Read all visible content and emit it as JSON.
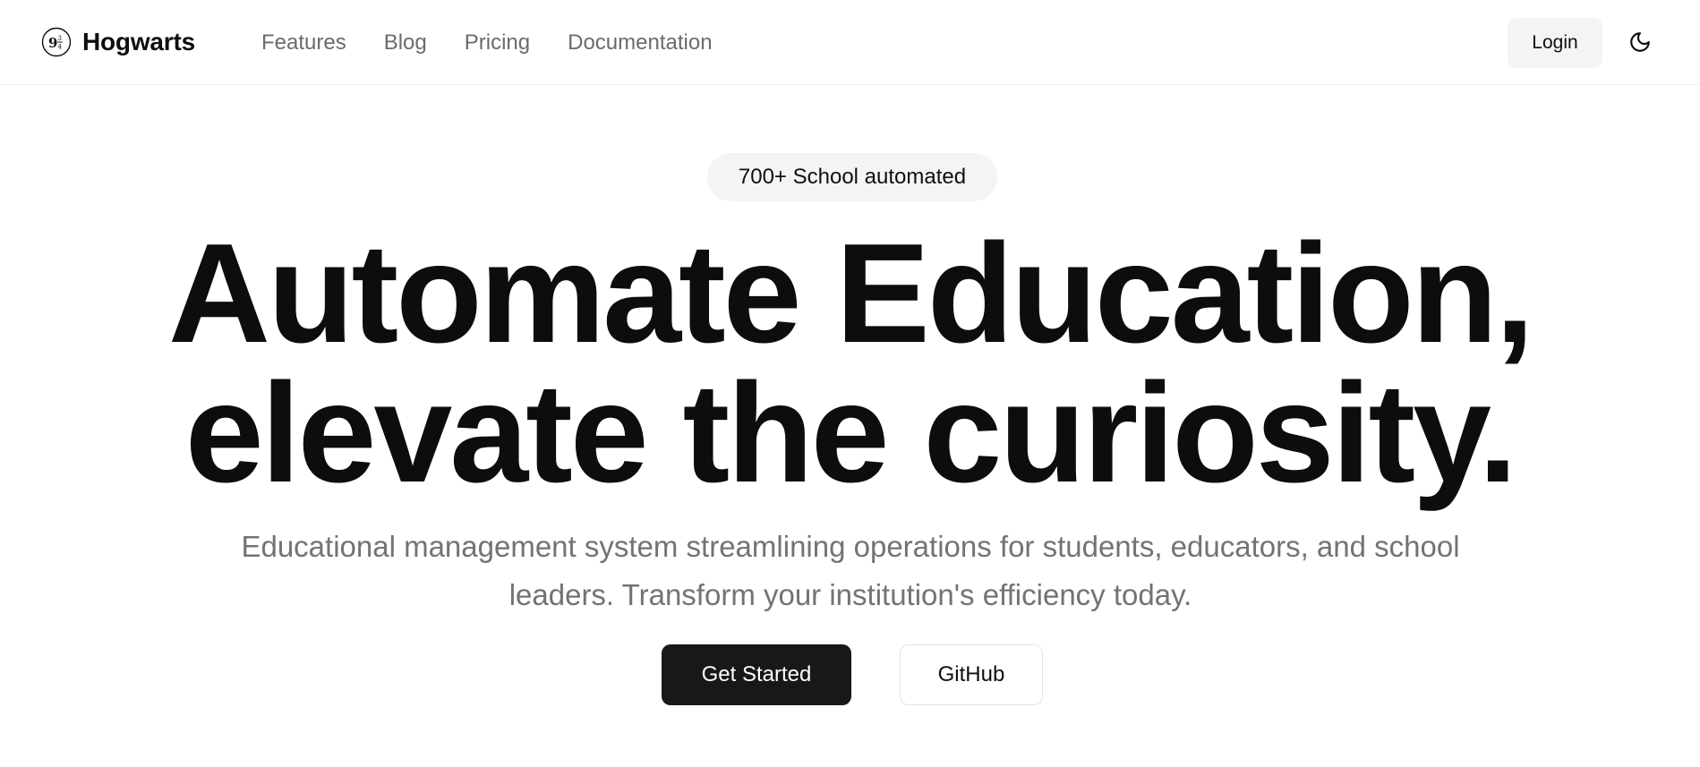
{
  "header": {
    "brand_name": "Hogwarts",
    "nav": [
      {
        "label": "Features"
      },
      {
        "label": "Blog"
      },
      {
        "label": "Pricing"
      },
      {
        "label": "Documentation"
      }
    ],
    "login_label": "Login",
    "theme_toggle_icon": "moon-icon"
  },
  "hero": {
    "badge": "700+ School automated",
    "title_line1": "Automate Education,",
    "title_line2": "elevate the curiosity.",
    "subtitle": "Educational management system streamlining operations for students, educators, and school leaders. Transform your institution's efficiency today.",
    "primary_cta": "Get Started",
    "secondary_cta": "GitHub"
  },
  "colors": {
    "text": "#0f0f10",
    "muted": "#737373",
    "primary_button": "#18181a",
    "badge_bg": "#f4f4f5"
  }
}
